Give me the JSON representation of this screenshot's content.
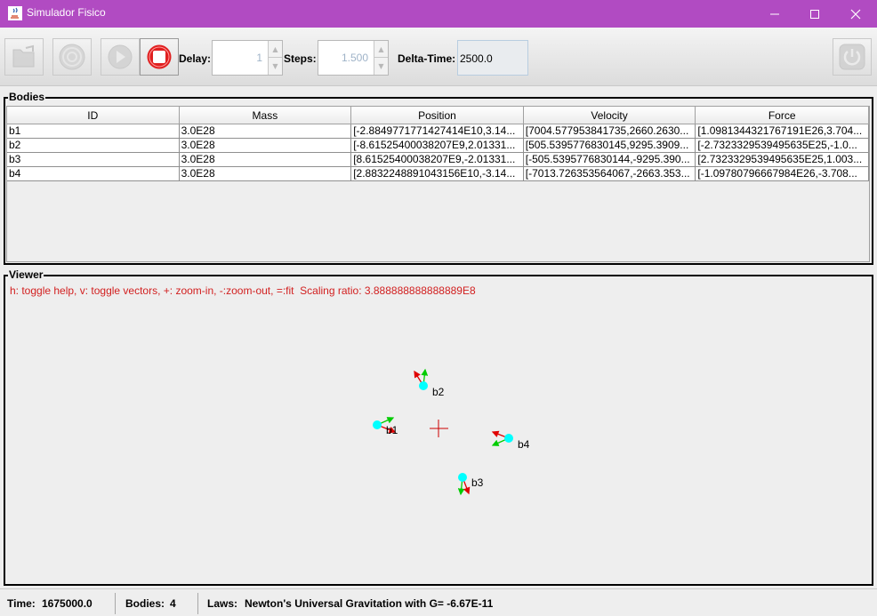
{
  "window": {
    "title": "Simulador Fisico"
  },
  "toolbar": {
    "open_icon": "folder-open-icon",
    "laws_icon": "physics-laws-icon",
    "run_icon": "play-icon",
    "stop_icon": "stop-icon",
    "exit_icon": "power-icon",
    "delay_label": "Delay:",
    "delay_value": "1",
    "steps_label": "Steps:",
    "steps_value": "1.500",
    "dt_label": "Delta-Time:",
    "dt_value": "2500.0"
  },
  "bodies": {
    "panel_title": "Bodies",
    "columns": [
      "ID",
      "Mass",
      "Position",
      "Velocity",
      "Force"
    ],
    "rows": [
      [
        "b1",
        "3.0E28",
        "[-2.8849771771427414E10,3.14...",
        "[7004.577953841735,2660.2630...",
        "[1.0981344321767191E26,3.704..."
      ],
      [
        "b2",
        "3.0E28",
        "[-8.61525400038207E9,2.01331...",
        "[505.5395776830145,9295.3909...",
        "[-2.7323329539495635E25,-1.0..."
      ],
      [
        "b3",
        "3.0E28",
        "[8.61525400038207E9,-2.01331...",
        "[-505.5395776830144,-9295.390...",
        "[2.7323329539495635E25,1.003..."
      ],
      [
        "b4",
        "3.0E28",
        "[2.8832248891043156E10,-3.14...",
        "[-7013.726353564067,-2663.353...",
        "[-1.09780796667984E26,-3.708..."
      ]
    ]
  },
  "viewer": {
    "panel_title": "Viewer",
    "help_text": "h: toggle help, v: toggle vectors, +: zoom-in, -:zoom-out, =:fit  Scaling ratio: 3.888888888888889E8",
    "body_labels": [
      "b1",
      "b2",
      "b3",
      "b4"
    ],
    "colors": {
      "body": "#00ffff",
      "velocity": "#00cc00",
      "force": "#e00000",
      "origin": "#cc0000",
      "help": "#d22020"
    }
  },
  "status": {
    "time_label": "Time:",
    "time_value": "1675000.0",
    "bodies_label": "Bodies:",
    "bodies_value": "4",
    "laws_label": "Laws:",
    "laws_value": "Newton's Universal Gravitation with G= -6.67E-11"
  }
}
